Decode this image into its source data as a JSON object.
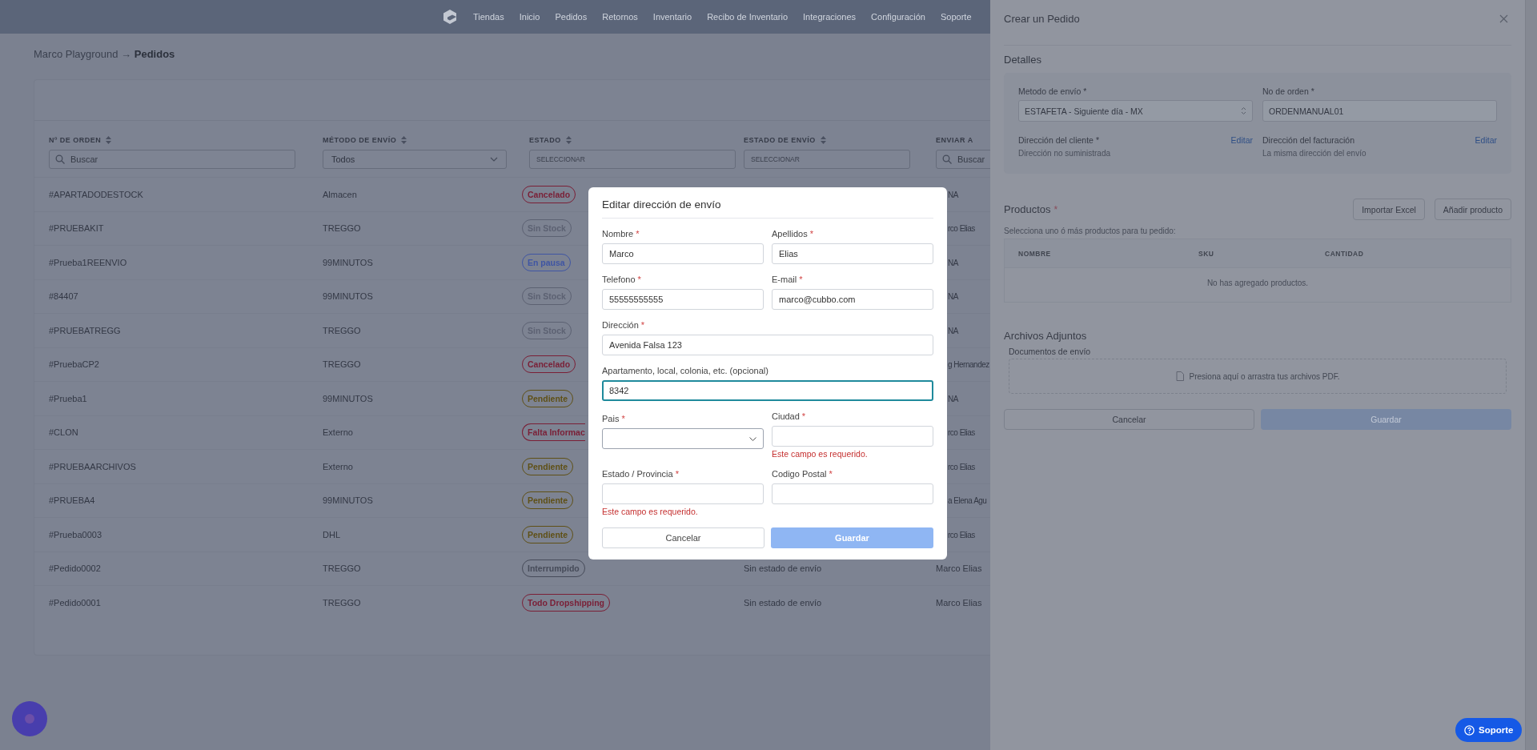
{
  "nav": {
    "items": [
      "Tiendas",
      "Inicio",
      "Pedidos",
      "Retornos",
      "Inventario",
      "Recibo de Inventario",
      "Integraciones",
      "Configuración",
      "Soporte"
    ]
  },
  "breadcrumb": "Marco Playground → **Pedidos**",
  "orders_table": {
    "columns": [
      {
        "label": "Nº DE ORDEN",
        "sortable": true
      },
      {
        "label": "MÉTODO DE ENVÍO",
        "sortable": true
      },
      {
        "label": "ESTADO",
        "sortable": true
      },
      {
        "label": "ESTADO DE ENVÍO",
        "sortable": true
      },
      {
        "label": "ENVIAR A",
        "sortable": false
      }
    ],
    "filters": [
      {
        "kind": "search",
        "placeholder": "Buscar"
      },
      {
        "kind": "select",
        "value": "Todos"
      },
      {
        "kind": "multiselect",
        "placeholder": "SELECCIONAR"
      },
      {
        "kind": "multiselect",
        "placeholder": "SELECCIONAR"
      },
      {
        "kind": "search",
        "placeholder": "Buscar"
      }
    ],
    "rows": [
      {
        "order": "#APARTADODESTOCK",
        "method": "Almacen",
        "status": {
          "label": "Cancelado",
          "color": "#7a1f36",
          "cut": false
        },
        "send_to": {
          "text": "NA",
          "cut": true
        }
      },
      {
        "order": "#PRUEBAKIT",
        "method": "TREGGO",
        "status": {
          "label": "Sin Stock",
          "color": "#5c6172",
          "cut": false
        },
        "send_to": {
          "text": "rco Elias",
          "cut": true
        }
      },
      {
        "order": "#Prueba1REENVIO",
        "method": "99MINUTOS",
        "status": {
          "label": "En pausa",
          "color": "#3f55a3",
          "cut": false
        },
        "send_to": {
          "text": "NA",
          "cut": true
        }
      },
      {
        "order": "#84407",
        "method": "99MINUTOS",
        "status": {
          "label": "Sin Stock",
          "color": "#5c6172",
          "cut": false
        },
        "send_to": {
          "text": "NA",
          "cut": true
        }
      },
      {
        "order": "#PRUEBATREGG",
        "method": "TREGGO",
        "status": {
          "label": "Sin Stock",
          "color": "#5c6172",
          "cut": false
        },
        "send_to": {
          "text": "NA",
          "cut": true
        }
      },
      {
        "order": "#PruebaCP2",
        "method": "TREGGO",
        "status": {
          "label": "Cancelado",
          "color": "#7a1f36",
          "cut": false
        },
        "send_to": {
          "text": "g Hernandez",
          "cut": true
        }
      },
      {
        "order": "#Prueba1",
        "method": "99MINUTOS",
        "status": {
          "label": "Pendiente",
          "color": "#5f5016",
          "cut": false
        },
        "send_to": {
          "text": "NA",
          "cut": true
        }
      },
      {
        "order": "#CLON",
        "method": "Externo",
        "status": {
          "label": "Falta Informac",
          "color": "#7a1f36",
          "cut": true
        },
        "send_to": {
          "text": "rco Elias",
          "cut": true
        }
      },
      {
        "order": "#PRUEBAARCHIVOS",
        "method": "Externo",
        "status": {
          "label": "Pendiente",
          "color": "#5f5016",
          "cut": false
        },
        "send_to": {
          "text": "rco Elias",
          "cut": true
        }
      },
      {
        "order": "#PRUEBA4",
        "method": "99MINUTOS",
        "status": {
          "label": "Pendiente",
          "color": "#5f5016",
          "cut": false
        },
        "send_to": {
          "text": "a Elena Agu",
          "cut": true
        }
      },
      {
        "order": "#Prueba0003",
        "method": "DHL",
        "status": {
          "label": "Pendiente",
          "color": "#5f5016",
          "cut": false
        },
        "send_to": {
          "text": "rco Elias",
          "cut": true
        }
      },
      {
        "order": "#Pedido0002",
        "method": "TREGGO",
        "status": {
          "label": "Interrumpido",
          "color": "#464b59",
          "cut": false
        },
        "shipping_status": "Sin estado de envío",
        "send_to": {
          "text": "Marco Elias",
          "cut": false
        }
      },
      {
        "order": "#Pedido0001",
        "method": "TREGGO",
        "status": {
          "label": "Todo Dropshipping",
          "color": "#7a1f36",
          "cut": false
        },
        "shipping_status": "Sin estado de envío",
        "send_to": {
          "text": "Marco Elias",
          "cut": false
        }
      }
    ]
  },
  "order_panel": {
    "title": "Crear un Pedido",
    "details": {
      "title": "Detalles",
      "shipping_method": {
        "label": "Metodo de envío *",
        "value": "ESTAFETA - Siguiente día - MX"
      },
      "order_number": {
        "label": "No de orden *",
        "value": "ORDENMANUAL01"
      },
      "addresses": [
        {
          "label": "Dirección del cliente *",
          "action": "Editar",
          "value": "Dirección no suministrada"
        },
        {
          "label": "Dirección del facturación",
          "action": "Editar",
          "value": "La misma dirección del envío"
        }
      ]
    },
    "products": {
      "title": "Productos",
      "required_mark": "*",
      "buttons": [
        "Importar Excel",
        "Añadir producto"
      ],
      "hint": "Selecciona uno ó más productos para tu pedido:",
      "columns": [
        "NOMBRE",
        "SKU",
        "CANTIDAD"
      ],
      "empty": "No has agregado productos."
    },
    "attachments": {
      "title": "Archivos Adjuntos",
      "label": "Documentos de envío",
      "dropzone": "Presiona aquí o arrastra tus archivos PDF."
    },
    "actions": {
      "cancel": "Cancelar",
      "save": "Guardar",
      "save_disabled": true
    }
  },
  "address_dialog": {
    "title": "Editar dirección de envío",
    "rows": [
      [
        {
          "kind": "text",
          "label": "Nombre",
          "required_mark": "*",
          "value": "Marco",
          "focused": false
        },
        {
          "kind": "text",
          "label": "Apellidos",
          "required_mark": "*",
          "value": "Elias",
          "focused": false
        }
      ],
      [
        {
          "kind": "text",
          "label": "Telefono",
          "required_mark": "*",
          "value": "55555555555",
          "focused": false
        },
        {
          "kind": "text",
          "label": "E-mail",
          "required_mark": "*",
          "value": "marco@cubbo.com",
          "focused": false
        }
      ],
      [
        {
          "kind": "text",
          "label": "Dirección",
          "required_mark": "*",
          "value": "Avenida Falsa 123",
          "focused": false
        }
      ],
      [
        {
          "kind": "text",
          "label": "Apartamento, local, colonia, etc. (opcional)",
          "value": "8342",
          "focused": true
        }
      ],
      [
        {
          "kind": "select",
          "label": "Pais",
          "required_mark": "*",
          "focused": false
        },
        {
          "kind": "text",
          "label": "Ciudad",
          "required_mark": "*",
          "focused": false,
          "error": "Este campo es requerido."
        }
      ],
      [
        {
          "kind": "text",
          "label": "Estado / Provincia",
          "required_mark": "*",
          "focused": false,
          "error": "Este campo es requerido."
        },
        {
          "kind": "text",
          "label": "Codigo Postal",
          "required_mark": "*",
          "focused": false
        }
      ]
    ],
    "actions": {
      "cancel": "Cancelar",
      "save": "Guardar",
      "save_disabled": true
    }
  },
  "support_button": {
    "label": "Soporte"
  }
}
